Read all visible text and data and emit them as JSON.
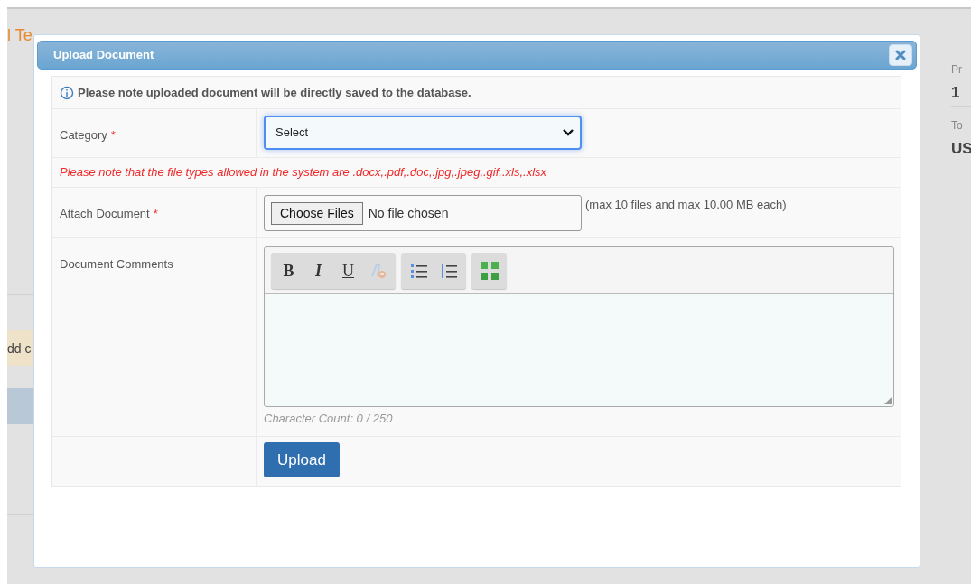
{
  "background": {
    "heading": "l Te",
    "side_items": [
      {
        "label": "Pr",
        "value": "1"
      },
      {
        "label": "To",
        "value": "US"
      }
    ],
    "banner": "dd c"
  },
  "dialog": {
    "title": "Upload Document",
    "info": "Please note uploaded document will be directly saved to the database.",
    "category": {
      "label": "Category",
      "required_mark": "*",
      "value": "Select"
    },
    "file_types_note": "Please note that the file types allowed in the system are .docx,.pdf,.doc,.jpg,.jpeg,.gif,.xls,.xlsx",
    "attach": {
      "label": "Attach Document",
      "required_mark": "*",
      "button": "Choose Files",
      "status": "No file chosen",
      "hint": "(max 10 files and max 10.00 MB each)"
    },
    "comments": {
      "label": "Document Comments",
      "toolbar": [
        {
          "kind": "bold",
          "text": "B",
          "disabled": false
        },
        {
          "kind": "italic",
          "text": "I",
          "disabled": false
        },
        {
          "kind": "underline",
          "text": "U",
          "disabled": false
        },
        {
          "kind": "clear",
          "disabled": true
        },
        {
          "kind": "bullets",
          "disabled": false
        },
        {
          "kind": "numbers",
          "disabled": false
        },
        {
          "kind": "maximize",
          "disabled": false
        }
      ],
      "character_count": "Character Count: 0 / 250"
    },
    "upload_button": "Upload"
  }
}
